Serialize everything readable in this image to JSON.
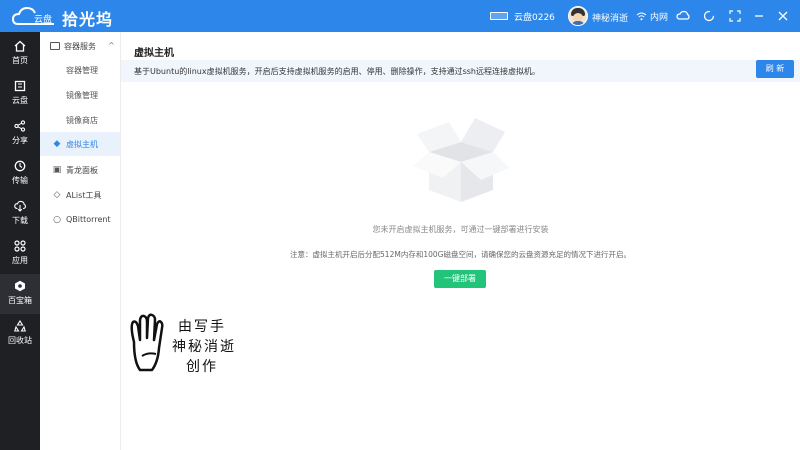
{
  "app": {
    "logo_text": "云盘",
    "name": "拾光坞"
  },
  "titlebar": {
    "device_label": "云盘0226",
    "user_name": "神秘消逝",
    "network_label": "内网"
  },
  "nav": {
    "items": [
      {
        "label": "首页",
        "icon": "home-icon"
      },
      {
        "label": "云盘",
        "icon": "cloud-disk-icon"
      },
      {
        "label": "分享",
        "icon": "share-icon"
      },
      {
        "label": "传输",
        "icon": "transfer-icon"
      },
      {
        "label": "下载",
        "icon": "download-icon"
      },
      {
        "label": "应用",
        "icon": "apps-icon"
      },
      {
        "label": "百宝箱",
        "icon": "toolbox-icon",
        "active": true
      },
      {
        "label": "回收站",
        "icon": "recycle-icon"
      }
    ]
  },
  "subnav": {
    "header": "容器服务",
    "sub_items": [
      "容器管理",
      "镜像管理",
      "镜像商店"
    ],
    "items": [
      {
        "label": "虚拟主机",
        "icon": "vm-icon",
        "active": true
      },
      {
        "label": "青龙面板",
        "icon": "panel-icon"
      },
      {
        "label": "AList工具",
        "icon": "alist-icon"
      },
      {
        "label": "QBittorrent",
        "icon": "qbittorrent-icon"
      }
    ]
  },
  "main": {
    "title": "虚拟主机",
    "description": "基于Ubuntu的linux虚拟机服务，开启后支持虚拟机服务的启用、停用、删除操作，支持通过ssh远程连接虚拟机。",
    "refresh_label": "刷 新",
    "empty_text": "您未开启虚拟主机服务，可通过一键部署进行安装",
    "note_text": "注意：虚拟主机开启后分配512M内存和100G磁盘空间，请确保您的云盘资源充足的情况下进行开启。",
    "deploy_label": "一键部署"
  },
  "watermark": {
    "line1": "由写手",
    "line2": "神秘消逝",
    "line3": "创作"
  },
  "colors": {
    "brand_blue": "#2d86ea",
    "nav_dark": "#1f2023",
    "deploy_green": "#22c47a"
  }
}
